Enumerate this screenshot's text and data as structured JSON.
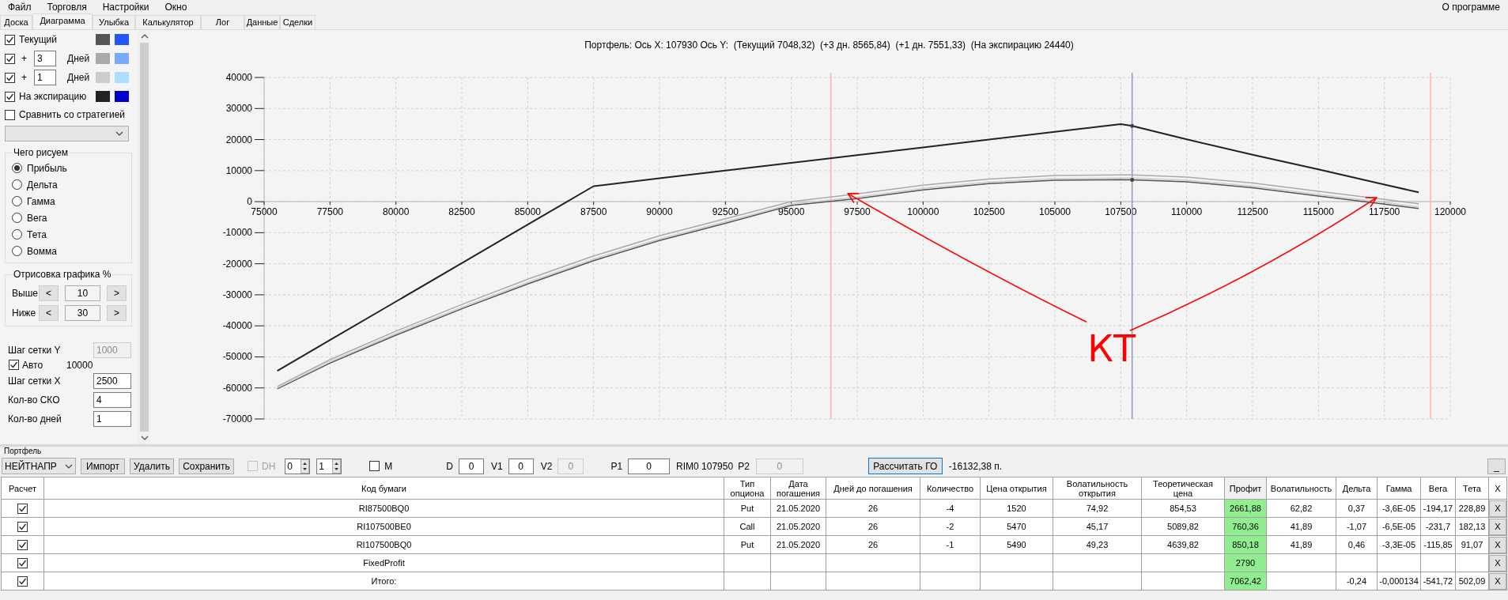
{
  "menu": {
    "items": [
      "Файл",
      "Торговля",
      "Настройки",
      "Окно"
    ],
    "about": "О программе"
  },
  "tabs": [
    {
      "label": "Доска",
      "selected": false
    },
    {
      "label": "Диаграмма",
      "selected": true
    },
    {
      "label": "Улыбка",
      "selected": false
    },
    {
      "label": "Калькулятор",
      "selected": false
    },
    {
      "label": "Лог",
      "selected": false
    },
    {
      "label": "Данные",
      "selected": false
    },
    {
      "label": "Сделки",
      "selected": false
    }
  ],
  "sidebar": {
    "curves": [
      {
        "kind": "plain",
        "label": "Текущий",
        "checked": true,
        "swatches": [
          {
            "color": "#555555"
          },
          {
            "color": "#2255ff"
          }
        ]
      },
      {
        "kind": "days",
        "prefix": "+",
        "days": "3",
        "unit": "Дней",
        "checked": true,
        "swatches": [
          {
            "color": "#aaaaaa"
          },
          {
            "color": "#77aaff"
          }
        ]
      },
      {
        "kind": "days",
        "prefix": "+",
        "days": "1",
        "unit": "Дней",
        "checked": true,
        "swatches": [
          {
            "color": "#cccccc"
          },
          {
            "color": "#aaddff"
          }
        ]
      },
      {
        "kind": "plain",
        "label": "На экспирацию",
        "checked": true,
        "swatches": [
          {
            "color": "#222222"
          },
          {
            "color": "#0000cc"
          }
        ]
      }
    ],
    "compare": {
      "label": "Сравнить со стратегией",
      "checked": false
    },
    "draw_group": {
      "title": "Чего рисуем",
      "options": [
        {
          "label": "Прибыль",
          "selected": true
        },
        {
          "label": "Дельта",
          "selected": false
        },
        {
          "label": "Гамма",
          "selected": false
        },
        {
          "label": "Вега",
          "selected": false
        },
        {
          "label": "Тета",
          "selected": false
        },
        {
          "label": "Вомма",
          "selected": false
        }
      ]
    },
    "range_group": {
      "title": "Отрисовка графика %",
      "rows": [
        {
          "label": "Выше",
          "dec": "<",
          "value": "10",
          "inc": ">"
        },
        {
          "label": "Ниже",
          "dec": "<",
          "value": "30",
          "inc": ">"
        }
      ]
    },
    "grid_y": {
      "label": "Шаг сетки Y",
      "value": "1000",
      "disabled": true
    },
    "auto": {
      "label": "Авто",
      "checked": true,
      "value": "10000"
    },
    "fields": [
      {
        "label": "Шаг сетки X",
        "value": "2500"
      },
      {
        "label": "Кол-во СКО",
        "value": "4"
      },
      {
        "label": "Кол-во дней",
        "value": "1"
      }
    ]
  },
  "chart": {
    "title": "Портфель: Ось X: 107930 Ось Y:  (Текущий 7048,32)  (+3 дн. 8565,84)  (+1 дн. 7551,33)  (На экспирацию 24440)",
    "chart_data": {
      "type": "line",
      "grid": true,
      "x": [
        75500,
        77500,
        80000,
        82500,
        85000,
        87500,
        90000,
        92500,
        95000,
        97500,
        100000,
        102500,
        105000,
        107500,
        107930,
        110000,
        112500,
        115000,
        117500,
        118800
      ],
      "series": [
        {
          "color": "#555555",
          "values": [
            -60300,
            -52000,
            -43000,
            -34500,
            -26500,
            -19000,
            -12500,
            -7000,
            -1200,
            1000,
            3800,
            5800,
            6900,
            7100,
            7000,
            6400,
            4500,
            1800,
            -800,
            -2200
          ]
        },
        {
          "color": "#aaaaaa",
          "values": [
            -59500,
            -50900,
            -41700,
            -33100,
            -25000,
            -17500,
            -11000,
            -5500,
            0,
            2500,
            5300,
            7300,
            8400,
            8600,
            8600,
            7900,
            6000,
            3300,
            700,
            -700
          ]
        },
        {
          "color": "#cccccc",
          "values": [
            -60000,
            -51600,
            -42500,
            -34000,
            -26000,
            -18500,
            -12000,
            -6500,
            -800,
            1500,
            4300,
            6300,
            7400,
            7600,
            7600,
            6900,
            5000,
            2300,
            -300,
            -1700
          ]
        },
        {
          "color": "#222222",
          "values": [
            -54500,
            -44600,
            -32200,
            -19800,
            -7400,
            5000,
            7500,
            10000,
            12500,
            15000,
            17500,
            20000,
            22500,
            25000,
            24400,
            20100,
            15100,
            10400,
            5500,
            3000
          ]
        }
      ],
      "xlim": [
        75000,
        120000
      ],
      "ylim": [
        -70000,
        40000
      ],
      "xticks": [
        75000,
        77500,
        80000,
        82500,
        85000,
        87500,
        90000,
        92500,
        95000,
        97500,
        100000,
        102500,
        105000,
        107500,
        110000,
        112500,
        115000,
        117500,
        120000
      ],
      "yticks": [
        40000,
        30000,
        20000,
        10000,
        0,
        -10000,
        -20000,
        -30000,
        -40000,
        -50000,
        -60000,
        -70000
      ],
      "ref_lines": [
        {
          "axis": "x",
          "value": 96500,
          "color": "#ffb0b0"
        },
        {
          "axis": "x",
          "value": 119250,
          "color": "#ffb0b0"
        },
        {
          "axis": "x",
          "value": 107930,
          "color": "#8a9ab8"
        }
      ],
      "annotations": [
        "КТ"
      ]
    }
  },
  "portfolio": {
    "title": "Портфель",
    "toolbar": {
      "strategy": "НЕЙТНАПР",
      "buttons": [
        "Импорт",
        "Удалить",
        "Сохранить"
      ],
      "dh": {
        "label": "DH",
        "checked": false,
        "disabled": true
      },
      "spinners": [
        "0",
        "1"
      ],
      "m": {
        "label": "M",
        "checked": false
      },
      "fields": [
        {
          "label": "D",
          "value": "0",
          "disabled": false
        },
        {
          "label": "V1",
          "value": "0",
          "disabled": false
        },
        {
          "label": "V2",
          "value": "0",
          "disabled": true
        },
        {
          "label": "P1",
          "value": "0",
          "disabled": false
        }
      ],
      "instrument": "RIM0 107950",
      "p2": {
        "label": "P2",
        "value": "0",
        "disabled": true
      },
      "calc_button": "Рассчитать ГО",
      "margin": "-16132,38 п.",
      "minimize": "_"
    },
    "table": {
      "columns": [
        {
          "label": "Расчет"
        },
        {
          "label": "Код бумаги"
        },
        {
          "label": "Тип опциона"
        },
        {
          "label": "Дата погашения"
        },
        {
          "label": "Дней до погашения"
        },
        {
          "label": "Количество"
        },
        {
          "label": "Цена открытия"
        },
        {
          "label": "Волатильность открытия"
        },
        {
          "label": "Теоретическая цена"
        },
        {
          "label": "Профит",
          "highlight": true
        },
        {
          "label": "Волатильность"
        },
        {
          "label": "Дельта"
        },
        {
          "label": "Гамма"
        },
        {
          "label": "Вега"
        },
        {
          "label": "Тета"
        },
        {
          "label": "X"
        }
      ],
      "rows": [
        {
          "cells": [
            {
              "kind": "check",
              "checked": true
            },
            "RI87500BQ0",
            "Put",
            "21.05.2020",
            "26",
            "-4",
            "1520",
            "74,92",
            "854,53",
            "2661,88",
            "62,82",
            "0,37",
            "-3,6E-05",
            "-194,17",
            "228,89",
            {
              "kind": "button",
              "label": "X"
            }
          ]
        },
        {
          "cells": [
            {
              "kind": "check",
              "checked": true
            },
            "RI107500BE0",
            "Call",
            "21.05.2020",
            "26",
            "-2",
            "5470",
            "45,17",
            "5089,82",
            "760,36",
            "41,89",
            "-1,07",
            "-6,5E-05",
            "-231,7",
            "182,13",
            {
              "kind": "button",
              "label": "X"
            }
          ]
        },
        {
          "cells": [
            {
              "kind": "check",
              "checked": true
            },
            "RI107500BQ0",
            "Put",
            "21.05.2020",
            "26",
            "-1",
            "5490",
            "49,23",
            "4639,82",
            "850,18",
            "41,89",
            "0,46",
            "-3,3E-05",
            "-115,85",
            "91,07",
            {
              "kind": "button",
              "label": "X"
            }
          ]
        },
        {
          "cells": [
            {
              "kind": "check",
              "checked": true
            },
            "FixedProfit",
            null,
            null,
            null,
            null,
            null,
            null,
            null,
            "2790",
            null,
            null,
            null,
            null,
            null,
            {
              "kind": "button",
              "label": "X"
            }
          ]
        },
        {
          "cells": [
            {
              "kind": "check",
              "checked": true
            },
            "Итого:",
            null,
            null,
            null,
            null,
            null,
            null,
            null,
            "7062,42",
            null,
            "-0,24",
            "-0,000134",
            "-541,72",
            "502,09",
            {
              "kind": "button",
              "label": "X"
            }
          ]
        }
      ]
    }
  }
}
